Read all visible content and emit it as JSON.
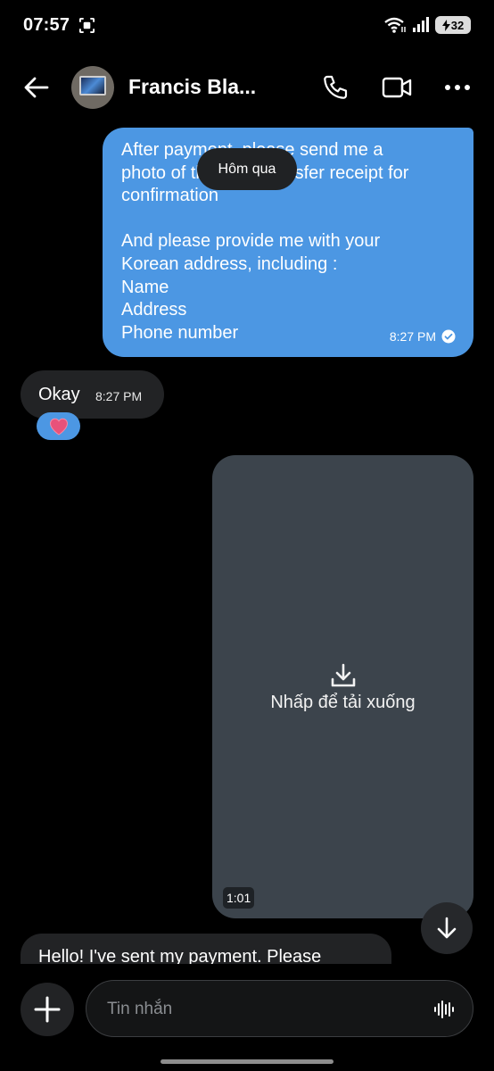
{
  "status_bar": {
    "time": "07:57",
    "battery": "32"
  },
  "header": {
    "contact_name": "Francis Bla..."
  },
  "messages": {
    "outgoing_text": "After payment, please send me a\nphoto of the bank transfer receipt for\nconfirmation\n\nAnd please provide me with your\nKorean address, including :\nName\nAddress\nPhone number",
    "outgoing_time": "8:27 PM",
    "date_separator": "Hôm qua",
    "incoming_text": "Okay",
    "incoming_time": "8:27 PM",
    "reaction": "❤️",
    "video_download_label": "Nhấp để tải xuống",
    "video_duration": "1:01",
    "partial_incoming_text": "Hello! I've sent my payment. Please"
  },
  "composer": {
    "placeholder": "Tin nhắn"
  },
  "colors": {
    "outgoing_bubble": "#4c97e3",
    "incoming_bubble": "#222325",
    "video_card": "#3c444c",
    "background": "#000000"
  }
}
